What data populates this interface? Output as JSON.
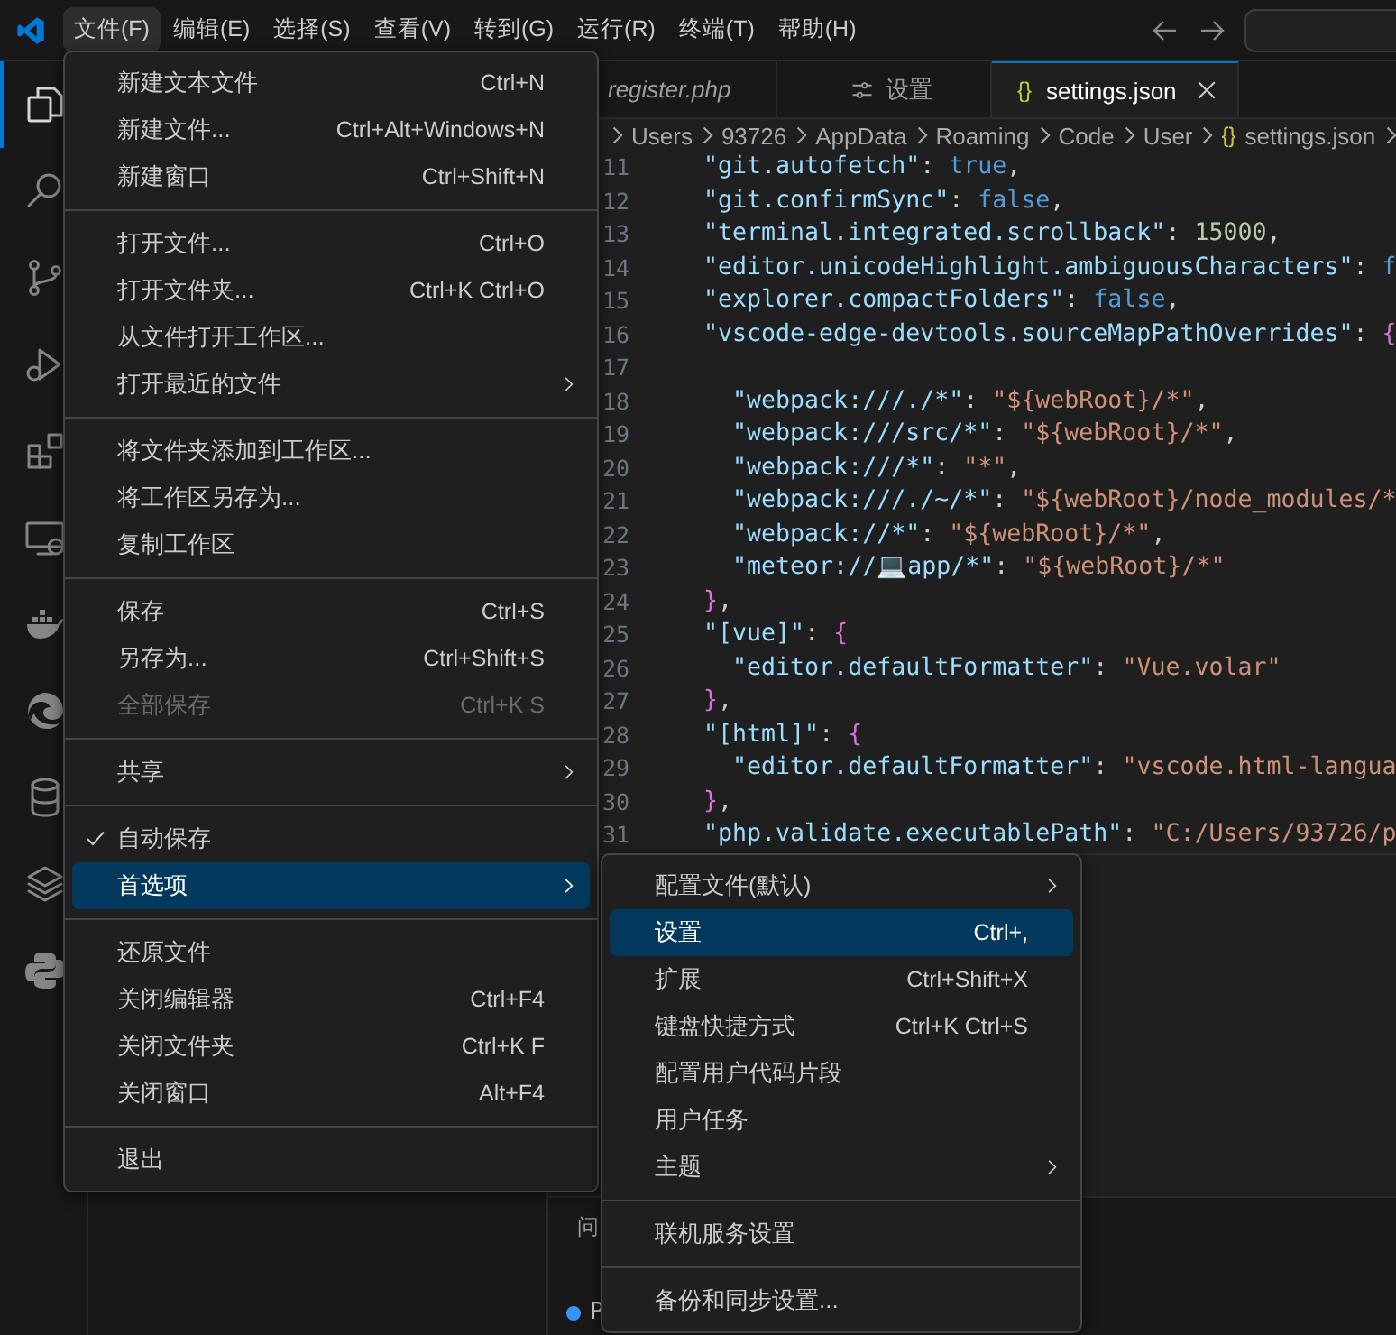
{
  "menu_bar": [
    {
      "label": "文件(F)",
      "selected": true
    },
    {
      "label": "编辑(E)",
      "selected": false
    },
    {
      "label": "选择(S)",
      "selected": false
    },
    {
      "label": "查看(V)",
      "selected": false
    },
    {
      "label": "转到(G)",
      "selected": false
    },
    {
      "label": "运行(R)",
      "selected": false
    },
    {
      "label": "终端(T)",
      "selected": false
    },
    {
      "label": "帮助(H)",
      "selected": false
    }
  ],
  "activity_bar": [
    {
      "kind": "files",
      "selected": true
    },
    {
      "kind": "search",
      "selected": false
    },
    {
      "kind": "branch",
      "selected": false
    },
    {
      "kind": "debug",
      "selected": false
    },
    {
      "kind": "extensions",
      "selected": false
    },
    {
      "kind": "monitor",
      "selected": false
    },
    {
      "kind": "whale",
      "selected": false
    },
    {
      "kind": "swirl",
      "selected": false
    },
    {
      "kind": "database",
      "selected": false
    },
    {
      "kind": "layers",
      "selected": false
    },
    {
      "kind": "snakes",
      "selected": false
    }
  ],
  "tabs": [
    {
      "label": "register.php",
      "kind": "plain",
      "preview": true,
      "selected": false
    },
    {
      "label": "设置",
      "kind": "settings",
      "preview": false,
      "selected": false
    },
    {
      "label": "settings.json",
      "kind": "json",
      "icon": "{}",
      "preview": false,
      "selected": true
    }
  ],
  "breadcrumb": [
    {
      "label": "Users"
    },
    {
      "label": "93726"
    },
    {
      "label": "AppData"
    },
    {
      "label": "Roaming"
    },
    {
      "label": "Code"
    },
    {
      "label": "User"
    },
    {
      "label": "settings.json",
      "icon": "{}"
    }
  ],
  "code_lines": [
    {
      "number": "11",
      "tokens": [
        {
          "kind": "key",
          "text": "  \"git.autofetch\""
        },
        {
          "kind": "punct",
          "text": ": "
        },
        {
          "kind": "bool",
          "text": "true"
        },
        {
          "kind": "punct",
          "text": ","
        }
      ]
    },
    {
      "number": "12",
      "tokens": [
        {
          "kind": "key",
          "text": "  \"git.confirmSync\""
        },
        {
          "kind": "punct",
          "text": ": "
        },
        {
          "kind": "bool",
          "text": "false"
        },
        {
          "kind": "punct",
          "text": ","
        }
      ]
    },
    {
      "number": "13",
      "tokens": [
        {
          "kind": "key",
          "text": "  \"terminal.integrated.scrollback\""
        },
        {
          "kind": "punct",
          "text": ": "
        },
        {
          "kind": "number",
          "text": "15000"
        },
        {
          "kind": "punct",
          "text": ","
        }
      ]
    },
    {
      "number": "14",
      "tokens": [
        {
          "kind": "key",
          "text": "  \"editor.unicodeHighlight.ambiguousCharacters\""
        },
        {
          "kind": "punct",
          "text": ": "
        },
        {
          "kind": "bool",
          "text": "f"
        }
      ]
    },
    {
      "number": "15",
      "tokens": [
        {
          "kind": "key",
          "text": "  \"explorer.compactFolders\""
        },
        {
          "kind": "punct",
          "text": ": "
        },
        {
          "kind": "bool",
          "text": "false"
        },
        {
          "kind": "punct",
          "text": ","
        }
      ]
    },
    {
      "number": "16",
      "tokens": [
        {
          "kind": "key",
          "text": "  \"vscode-edge-devtools.sourceMapPathOverrides\""
        },
        {
          "kind": "punct",
          "text": ": "
        },
        {
          "kind": "bracket",
          "text": "{"
        }
      ]
    },
    {
      "number": "17"
    },
    {
      "number": "18",
      "tokens": [
        {
          "kind": "key",
          "text": "    \"webpack:///./*\""
        },
        {
          "kind": "punct",
          "text": ": "
        },
        {
          "kind": "string",
          "text": "\"${webRoot}/*\""
        },
        {
          "kind": "punct",
          "text": ","
        }
      ]
    },
    {
      "number": "19",
      "tokens": [
        {
          "kind": "key",
          "text": "    \"webpack:///src/*\""
        },
        {
          "kind": "punct",
          "text": ": "
        },
        {
          "kind": "string",
          "text": "\"${webRoot}/*\""
        },
        {
          "kind": "punct",
          "text": ","
        }
      ]
    },
    {
      "number": "20",
      "tokens": [
        {
          "kind": "key",
          "text": "    \"webpack:///*\""
        },
        {
          "kind": "punct",
          "text": ": "
        },
        {
          "kind": "string",
          "text": "\"*\""
        },
        {
          "kind": "punct",
          "text": ","
        }
      ]
    },
    {
      "number": "21",
      "tokens": [
        {
          "kind": "key",
          "text": "    \"webpack:///./~/*\""
        },
        {
          "kind": "punct",
          "text": ": "
        },
        {
          "kind": "string",
          "text": "\"${webRoot}/node_modules/*"
        }
      ]
    },
    {
      "number": "22",
      "tokens": [
        {
          "kind": "key",
          "text": "    \"webpack://*\""
        },
        {
          "kind": "punct",
          "text": ": "
        },
        {
          "kind": "string",
          "text": "\"${webRoot}/*\""
        },
        {
          "kind": "punct",
          "text": ","
        }
      ]
    },
    {
      "number": "23",
      "tokens": [
        {
          "kind": "key",
          "text": "    \"meteor://💻app/*\""
        },
        {
          "kind": "punct",
          "text": ": "
        },
        {
          "kind": "string",
          "text": "\"${webRoot}/*\""
        }
      ]
    },
    {
      "number": "24",
      "tokens": [
        {
          "kind": "bracket",
          "text": "  }"
        },
        {
          "kind": "punct",
          "text": ","
        }
      ]
    },
    {
      "number": "25",
      "tokens": [
        {
          "kind": "key",
          "text": "  \"[vue]\""
        },
        {
          "kind": "punct",
          "text": ": "
        },
        {
          "kind": "bracket",
          "text": "{"
        }
      ]
    },
    {
      "number": "26",
      "tokens": [
        {
          "kind": "key",
          "text": "    \"editor.defaultFormatter\""
        },
        {
          "kind": "punct",
          "text": ": "
        },
        {
          "kind": "string",
          "text": "\"Vue.volar\""
        }
      ]
    },
    {
      "number": "27",
      "tokens": [
        {
          "kind": "bracket",
          "text": "  }"
        },
        {
          "kind": "punct",
          "text": ","
        }
      ]
    },
    {
      "number": "28",
      "tokens": [
        {
          "kind": "key",
          "text": "  \"[html]\""
        },
        {
          "kind": "punct",
          "text": ": "
        },
        {
          "kind": "bracket",
          "text": "{"
        }
      ]
    },
    {
      "number": "29",
      "tokens": [
        {
          "kind": "key",
          "text": "    \"editor.defaultFormatter\""
        },
        {
          "kind": "punct",
          "text": ": "
        },
        {
          "kind": "string",
          "text": "\"vscode.html-langua"
        }
      ]
    },
    {
      "number": "30",
      "tokens": [
        {
          "kind": "bracket",
          "text": "  }"
        },
        {
          "kind": "punct",
          "text": ","
        }
      ]
    },
    {
      "number": "31",
      "tokens": [
        {
          "kind": "key",
          "text": "  \"php.validate.executablePath\""
        },
        {
          "kind": "punct",
          "text": ": "
        },
        {
          "kind": "string",
          "text": "\"C:/Users/93726/p"
        }
      ]
    }
  ],
  "panel": {
    "tabs": [
      {
        "label": "问"
      }
    ],
    "terminal_lines": [
      {
        "text": "P"
      }
    ]
  },
  "file_menu": {
    "groups": [
      {
        "items": [
          {
            "label": "新建文本文件",
            "shortcut": "Ctrl+N",
            "checked": false,
            "disabled": false,
            "selected": false
          },
          {
            "label": "新建文件...",
            "shortcut": "Ctrl+Alt+Windows+N",
            "checked": false,
            "disabled": false,
            "selected": false
          },
          {
            "label": "新建窗口",
            "shortcut": "Ctrl+Shift+N",
            "checked": false,
            "disabled": false,
            "selected": false
          }
        ]
      },
      {
        "items": [
          {
            "label": "打开文件...",
            "shortcut": "Ctrl+O",
            "checked": false,
            "disabled": false,
            "selected": false
          },
          {
            "label": "打开文件夹...",
            "shortcut": "Ctrl+K Ctrl+O",
            "checked": false,
            "disabled": false,
            "selected": false
          },
          {
            "label": "从文件打开工作区...",
            "checked": false,
            "disabled": false,
            "selected": false
          },
          {
            "label": "打开最近的文件",
            "submenu": true,
            "checked": false,
            "disabled": false,
            "selected": false
          }
        ]
      },
      {
        "items": [
          {
            "label": "将文件夹添加到工作区...",
            "checked": false,
            "disabled": false,
            "selected": false
          },
          {
            "label": "将工作区另存为...",
            "checked": false,
            "disabled": false,
            "selected": false
          },
          {
            "label": "复制工作区",
            "checked": false,
            "disabled": false,
            "selected": false
          }
        ]
      },
      {
        "items": [
          {
            "label": "保存",
            "shortcut": "Ctrl+S",
            "checked": false,
            "disabled": false,
            "selected": false
          },
          {
            "label": "另存为...",
            "shortcut": "Ctrl+Shift+S",
            "checked": false,
            "disabled": false,
            "selected": false
          },
          {
            "label": "全部保存",
            "shortcut": "Ctrl+K S",
            "checked": false,
            "disabled": true,
            "selected": false
          }
        ]
      },
      {
        "items": [
          {
            "label": "共享",
            "submenu": true,
            "checked": false,
            "disabled": false,
            "selected": false
          }
        ]
      },
      {
        "items": [
          {
            "label": "自动保存",
            "checked": true,
            "disabled": false,
            "selected": false
          },
          {
            "label": "首选项",
            "submenu": true,
            "checked": false,
            "disabled": false,
            "selected": true
          }
        ]
      },
      {
        "items": [
          {
            "label": "还原文件",
            "checked": false,
            "disabled": false,
            "selected": false
          },
          {
            "label": "关闭编辑器",
            "shortcut": "Ctrl+F4",
            "checked": false,
            "disabled": false,
            "selected": false
          },
          {
            "label": "关闭文件夹",
            "shortcut": "Ctrl+K F",
            "checked": false,
            "disabled": false,
            "selected": false
          },
          {
            "label": "关闭窗口",
            "shortcut": "Alt+F4",
            "checked": false,
            "disabled": false,
            "selected": false
          }
        ]
      },
      {
        "items": [
          {
            "label": "退出",
            "checked": false,
            "disabled": false,
            "selected": false
          }
        ]
      }
    ]
  },
  "preferences_submenu": {
    "groups": [
      {
        "items": [
          {
            "label": "配置文件(默认)",
            "submenu": true,
            "checked": false,
            "disabled": false,
            "selected": false
          },
          {
            "label": "设置",
            "shortcut": "Ctrl+,",
            "checked": false,
            "disabled": false,
            "selected": true
          },
          {
            "label": "扩展",
            "shortcut": "Ctrl+Shift+X",
            "checked": false,
            "disabled": false,
            "selected": false
          },
          {
            "label": "键盘快捷方式",
            "shortcut": "Ctrl+K Ctrl+S",
            "checked": false,
            "disabled": false,
            "selected": false
          },
          {
            "label": "配置用户代码片段",
            "checked": false,
            "disabled": false,
            "selected": false
          },
          {
            "label": "用户任务",
            "checked": false,
            "disabled": false,
            "selected": false
          },
          {
            "label": "主题",
            "submenu": true,
            "checked": false,
            "disabled": false,
            "selected": false
          }
        ]
      },
      {
        "items": [
          {
            "label": "联机服务设置",
            "checked": false,
            "disabled": false,
            "selected": false
          }
        ]
      },
      {
        "items": [
          {
            "label": "备份和同步设置...",
            "checked": false,
            "disabled": false,
            "selected": false
          }
        ]
      }
    ]
  }
}
